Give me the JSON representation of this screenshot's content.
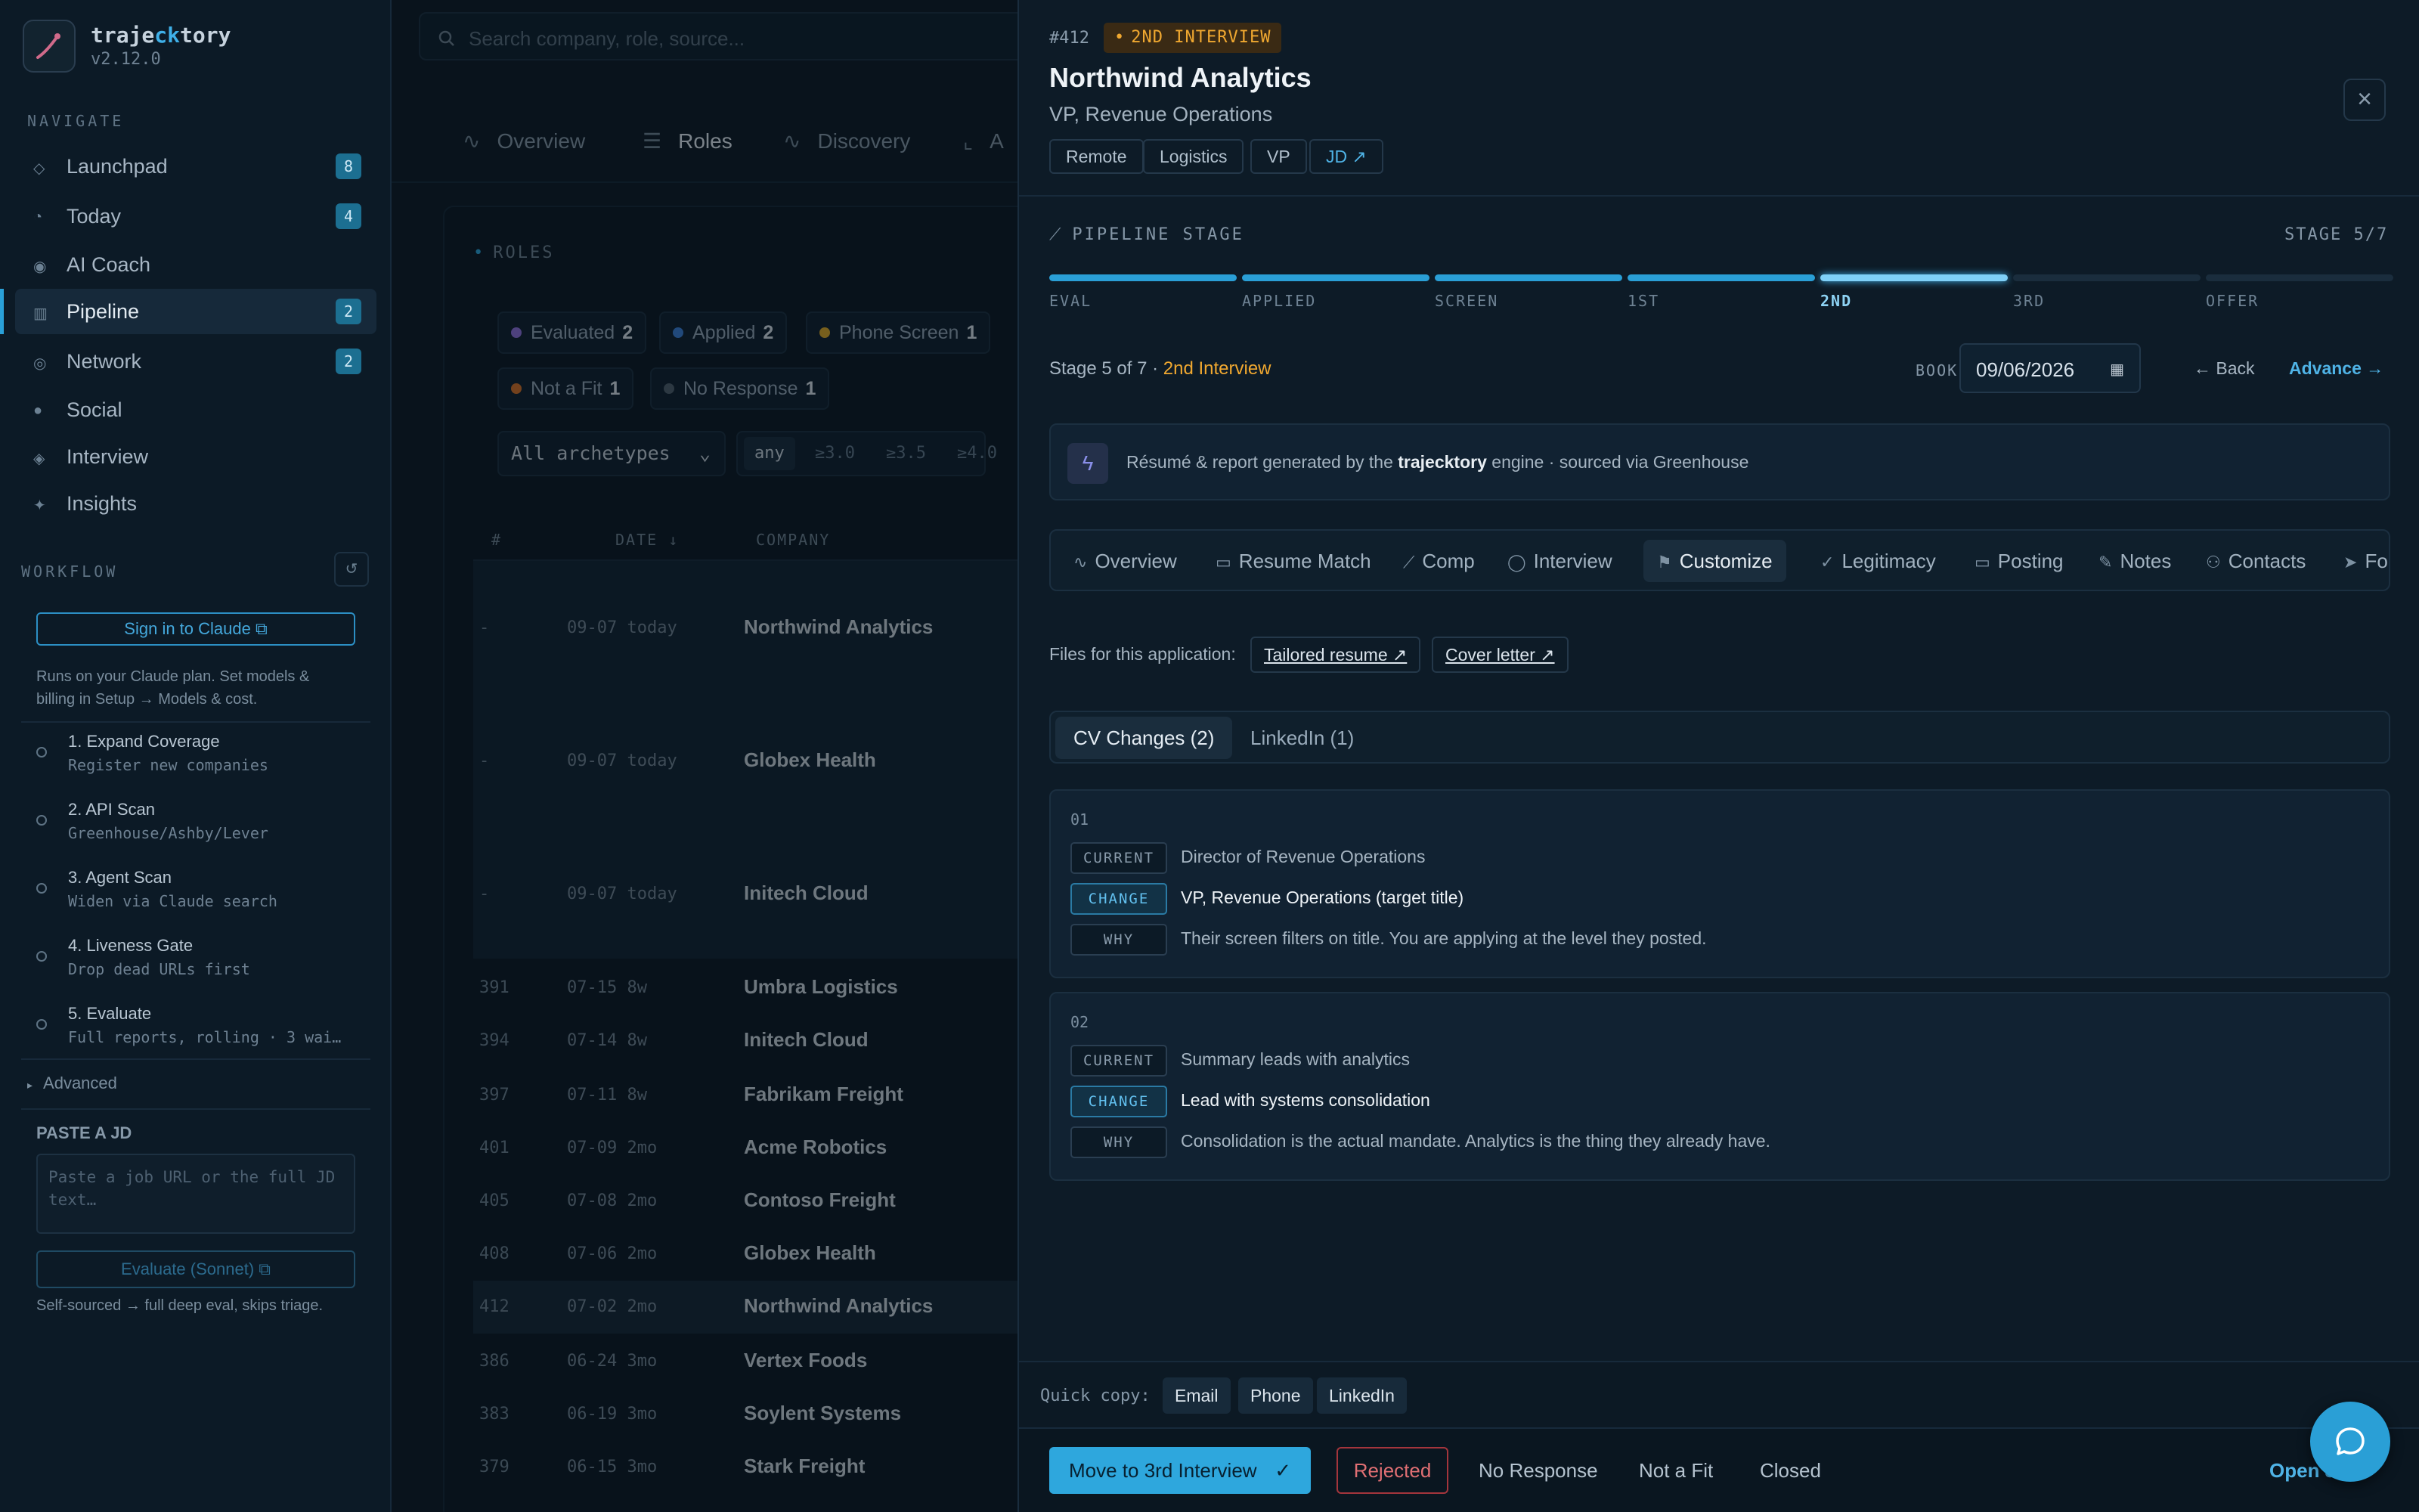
{
  "app": {
    "name_a": "traje",
    "name_b": "ck",
    "name_c": "tory",
    "version": "v2.12.0"
  },
  "colors": {
    "accent": "#2aa0d8",
    "warning": "#f0a830",
    "danger": "#e06f73",
    "bg": "#0b1621"
  },
  "sidebar": {
    "navigate_heading": "NAVIGATE",
    "items": [
      {
        "icon": "rocket-icon",
        "label": "Launchpad",
        "badge": "8"
      },
      {
        "icon": "clock-icon",
        "label": "Today",
        "badge": "4"
      },
      {
        "icon": "sparkle-icon",
        "label": "AI Coach",
        "badge": ""
      },
      {
        "icon": "kanban-icon",
        "label": "Pipeline",
        "badge": "2"
      },
      {
        "icon": "network-icon",
        "label": "Network",
        "badge": "2"
      },
      {
        "icon": "globe-icon",
        "label": "Social",
        "badge": ""
      },
      {
        "icon": "diamond-icon",
        "label": "Interview",
        "badge": ""
      },
      {
        "icon": "star-icon",
        "label": "Insights",
        "badge": ""
      }
    ],
    "workflow_heading": "WORKFLOW",
    "signin_label": "Sign in to Claude ⧉",
    "plan_note_1": "Runs on your Claude plan. Set models &",
    "plan_note_2": "billing in Setup → Models & cost.",
    "steps": [
      {
        "title": "1. Expand Coverage",
        "sub": "Register new companies"
      },
      {
        "title": "2. API Scan",
        "sub": "Greenhouse/Ashby/Lever"
      },
      {
        "title": "3. Agent Scan",
        "sub": "Widen via Claude search"
      },
      {
        "title": "4. Liveness Gate",
        "sub": "Drop dead URLs first"
      },
      {
        "title": "5. Evaluate",
        "sub": "Full reports, rolling · 3 wai…"
      }
    ],
    "advanced_label": "Advanced",
    "paste_heading": "PASTE A JD",
    "paste_placeholder": "Paste a job URL or the full JD text…",
    "evaluate_label": "Evaluate (Sonnet) ⧉",
    "self_note": "Self-sourced → full deep eval, skips triage."
  },
  "main": {
    "search_placeholder": "Search company, role, source...",
    "tabs": [
      "Overview",
      "Roles",
      "Discovery",
      "A"
    ],
    "roles_heading": "ROLES",
    "filters": [
      {
        "label": "Evaluated",
        "count": "2",
        "color": "#8a6fd9"
      },
      {
        "label": "Applied",
        "count": "2",
        "color": "#3b7fd6"
      },
      {
        "label": "Phone Screen",
        "count": "1",
        "color": "#d8a72b"
      },
      {
        "label": "Not a Fit",
        "count": "1",
        "color": "#d0702a"
      },
      {
        "label": "No Response",
        "count": "1",
        "color": "#4f5f6d"
      }
    ],
    "archetype_select": "All archetypes",
    "score_filters": [
      "any",
      "≥3.0",
      "≥3.5",
      "≥4.0"
    ],
    "columns": {
      "num": "#",
      "date": "DATE ↓",
      "company": "COMPANY"
    },
    "rows": [
      {
        "num": "-",
        "date": "09-07 today",
        "company": "Northwind Analytics"
      },
      {
        "num": "-",
        "date": "09-07 today",
        "company": "Globex Health"
      },
      {
        "num": "-",
        "date": "09-07 today",
        "company": "Initech Cloud"
      },
      {
        "num": "391",
        "date": "07-15 8w",
        "company": "Umbra Logistics"
      },
      {
        "num": "394",
        "date": "07-14 8w",
        "company": "Initech Cloud"
      },
      {
        "num": "397",
        "date": "07-11 8w",
        "company": "Fabrikam Freight"
      },
      {
        "num": "401",
        "date": "07-09 2mo",
        "company": "Acme Robotics"
      },
      {
        "num": "405",
        "date": "07-08 2mo",
        "company": "Contoso Freight"
      },
      {
        "num": "408",
        "date": "07-06 2mo",
        "company": "Globex Health"
      },
      {
        "num": "412",
        "date": "07-02 2mo",
        "company": "Northwind Analytics"
      },
      {
        "num": "386",
        "date": "06-24 3mo",
        "company": "Vertex Foods"
      },
      {
        "num": "383",
        "date": "06-19 3mo",
        "company": "Soylent Systems"
      },
      {
        "num": "379",
        "date": "06-15 3mo",
        "company": "Stark Freight"
      }
    ]
  },
  "drawer": {
    "id": "#412",
    "stage_badge": "2ND INTERVIEW",
    "company": "Northwind Analytics",
    "role": "VP, Revenue Operations",
    "tags": [
      "Remote",
      "Logistics",
      "VP"
    ],
    "jd_link": "JD ↗",
    "pipeline_heading": "PIPELINE STAGE",
    "stage_counter": "STAGE 5/7",
    "stages": [
      "EVAL",
      "APPLIED",
      "SCREEN",
      "1ST",
      "2ND",
      "3RD",
      "OFFER"
    ],
    "current_stage_index": 4,
    "stage_text_a": "Stage 5 of 7 · ",
    "stage_text_b": "2nd Interview",
    "booked_label": "BOOKED",
    "booked_date": "09/06/2026",
    "back_label": "← Back",
    "advance_label": "Advance →",
    "info_a": "Résumé & report generated by the ",
    "info_brand": "trajecktory",
    "info_b": " engine · sourced via Greenhouse",
    "tabs": [
      {
        "icon": "pulse-icon",
        "label": "Overview"
      },
      {
        "icon": "briefcase-icon",
        "label": "Resume Match"
      },
      {
        "icon": "trend-icon",
        "label": "Comp"
      },
      {
        "icon": "chat-icon",
        "label": "Interview"
      },
      {
        "icon": "flag-icon",
        "label": "Customize"
      },
      {
        "icon": "check-icon",
        "label": "Legitimacy"
      },
      {
        "icon": "briefcase-icon",
        "label": "Posting"
      },
      {
        "icon": "pencil-icon",
        "label": "Notes"
      },
      {
        "icon": "people-icon",
        "label": "Contacts"
      },
      {
        "icon": "send-icon",
        "label": "Fo"
      }
    ],
    "files_label": "Files for this application:",
    "tailored_resume": "Tailored resume ↗",
    "cover_letter": "Cover letter ↗",
    "sub_tabs": [
      "CV Changes (2)",
      "LinkedIn (1)"
    ],
    "labels": {
      "current": "CURRENT",
      "change": "CHANGE",
      "why": "WHY"
    },
    "changes": [
      {
        "idx": "01",
        "current": "Director of Revenue Operations",
        "change": "VP, Revenue Operations (target title)",
        "why": "Their screen filters on title. You are applying at the level they posted."
      },
      {
        "idx": "02",
        "current": "Summary leads with analytics",
        "change": "Lead with systems consolidation",
        "why": "Consolidation is the actual mandate. Analytics is the thing they already have."
      }
    ],
    "quick_copy_label": "Quick copy:",
    "quick_copy": [
      "Email",
      "Phone",
      "LinkedIn"
    ],
    "actions": {
      "move": "Move to 3rd Interview",
      "rejected": "Rejected",
      "no_response": "No Response",
      "not_fit": "Not a Fit",
      "closed": "Closed",
      "open": "Open J"
    }
  }
}
